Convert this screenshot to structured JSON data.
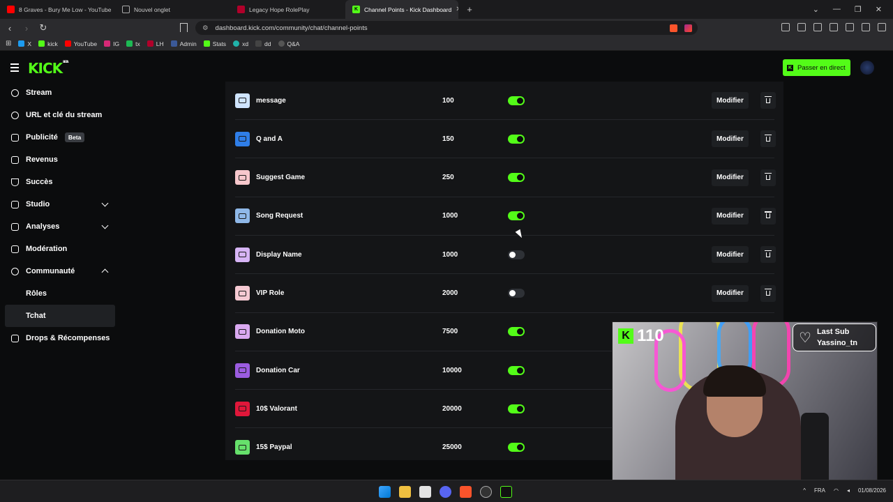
{
  "browser": {
    "tabs": [
      {
        "label": "8 Graves - Bury Me Low - YouTube",
        "color": "#ff0000"
      },
      {
        "label": "Nouvel onglet",
        "color": "#888888"
      },
      {
        "label": "Legacy Hope RolePlay",
        "color": "#b0002a"
      },
      {
        "label": "Channel Points - Kick Dashboard",
        "color": "#53fc18",
        "active": true
      }
    ],
    "url": "dashboard.kick.com/community/chat/channel-points",
    "bookmarks": [
      {
        "label": "X",
        "color": "#1d9bf0"
      },
      {
        "label": "kick",
        "color": "#53fc18"
      },
      {
        "label": "YouTube",
        "color": "#ff0000"
      },
      {
        "label": "IG",
        "color": "#d62976"
      },
      {
        "label": "tx",
        "color": "#1db954"
      },
      {
        "label": "LH",
        "color": "#b0002a"
      },
      {
        "label": "Admin",
        "color": "#3b5998"
      },
      {
        "label": "Stats",
        "color": "#53fc18"
      },
      {
        "label": "xd",
        "color": "#20b2aa"
      },
      {
        "label": "dd",
        "color": "#2d2d2d"
      },
      {
        "label": "Q&A",
        "color": "#222222"
      }
    ]
  },
  "header": {
    "logo": "KICK",
    "logo_tag": "BETA",
    "go_live": "Passer en direct"
  },
  "sidebar": {
    "items": [
      {
        "label": "Stream"
      },
      {
        "label": "URL et clé du stream"
      },
      {
        "label": "Publicité",
        "badge": "Beta"
      },
      {
        "label": "Revenus"
      },
      {
        "label": "Succès"
      },
      {
        "label": "Studio",
        "chevron": "down"
      },
      {
        "label": "Analyses",
        "chevron": "down"
      },
      {
        "label": "Modération"
      },
      {
        "label": "Communauté",
        "chevron": "up"
      },
      {
        "label": "Rôles",
        "sub": true
      },
      {
        "label": "Tchat",
        "sub": true,
        "selected": true
      },
      {
        "label": "Drops & Récompenses"
      }
    ]
  },
  "rewards": {
    "edit_label": "Modifier",
    "rows": [
      {
        "name": "message",
        "cost": "100",
        "enabled": true,
        "color": "#cfe4ff"
      },
      {
        "name": "Q and A",
        "cost": "150",
        "enabled": true,
        "color": "#2f7ee8"
      },
      {
        "name": "Suggest Game",
        "cost": "250",
        "enabled": true,
        "color": "#f7c7cc"
      },
      {
        "name": "Song Request",
        "cost": "1000",
        "enabled": true,
        "color": "#8fb8e8"
      },
      {
        "name": "Display Name",
        "cost": "1000",
        "enabled": false,
        "color": "#d6b4f5"
      },
      {
        "name": "VIP Role",
        "cost": "2000",
        "enabled": false,
        "color": "#f5c9d2"
      },
      {
        "name": "Donation Moto",
        "cost": "7500",
        "enabled": true,
        "color": "#d9a8f0"
      },
      {
        "name": "Donation Car",
        "cost": "10000",
        "enabled": true,
        "color": "#9b5ce0"
      },
      {
        "name": "10$ Valorant",
        "cost": "20000",
        "enabled": true,
        "color": "#e0173a"
      },
      {
        "name": "15$ Paypal",
        "cost": "25000",
        "enabled": true,
        "color": "#66e06b"
      }
    ]
  },
  "overlay": {
    "kick_count": "110",
    "last_sub_title": "Last Sub",
    "last_sub_name": "Yassino_tn"
  },
  "taskbar": {
    "lang": "FRA",
    "date": "01/08/2026"
  }
}
